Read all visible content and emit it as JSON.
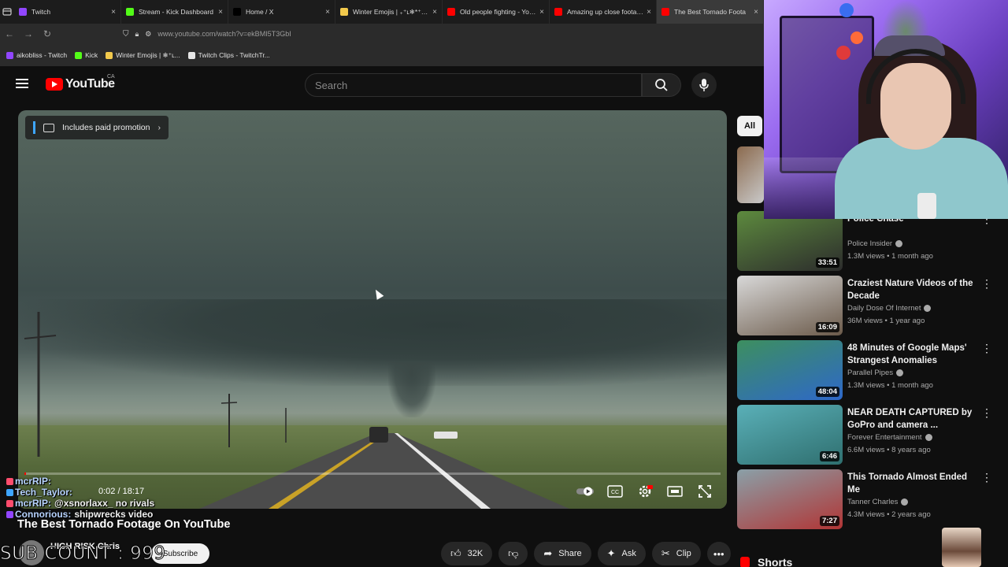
{
  "browser": {
    "tabs": [
      {
        "label": "Twitch",
        "color": "#9146ff",
        "active": false
      },
      {
        "label": "Stream - Kick Dashboard",
        "color": "#53fc18",
        "active": false
      },
      {
        "label": "Home / X",
        "color": "#000000",
        "active": false
      },
      {
        "label": "Winter Emojis | ₊⁺ʟ❄︎*⁺‧₊☃︎",
        "color": "#f2c94c",
        "active": false
      },
      {
        "label": "Old people fighting - YouTu",
        "color": "#ff0000",
        "active": false
      },
      {
        "label": "Amazing up close footage o",
        "color": "#ff0000",
        "active": false
      },
      {
        "label": "The Best Tornado Foota",
        "color": "#ff0000",
        "active": true
      }
    ],
    "url": "www.youtube.com/watch?v=ekBMI5T3GbI",
    "bookmarks": [
      {
        "label": "aikobliss - Twitch",
        "color": "#9146ff"
      },
      {
        "label": "Kick",
        "color": "#53fc18"
      },
      {
        "label": "Winter Emojis | ❄︎⁺ʟ...",
        "color": "#f2c94c"
      },
      {
        "label": "Twitch Clips - TwitchTr...",
        "color": "#e6e6e6"
      }
    ]
  },
  "youtube": {
    "logo_text": "YouTube",
    "country": "CA",
    "search_placeholder": "Search"
  },
  "video": {
    "promo_label": "Includes paid promotion",
    "time": "0:02 / 18:17",
    "progress": 0.002,
    "title": "The Best Tornado Footage On YouTube",
    "channel": "HIGH RISK Chris",
    "subscribe_label": "Subscribe",
    "like_count": "32K",
    "share_label": "Share",
    "ask_label": "Ask",
    "clip_label": "Clip"
  },
  "overlay": {
    "subcount": "SUB COUNT : 999",
    "chat": [
      {
        "name": "mcrRIP:",
        "text": ""
      },
      {
        "name": "Tech_Taylor:",
        "text": ""
      },
      {
        "name": "mcrRIP:",
        "text": "@xsnorlaxx_ no rivals"
      },
      {
        "name": "Connorious:",
        "text": "shipwrecks video"
      }
    ]
  },
  "sidebar": {
    "chip_all": "All",
    "recommendations": [
      {
        "title": "Police Chase",
        "channel": "Police Insider",
        "meta": "1.3M views • 1 month ago",
        "duration": "33:51",
        "thumb_a": "#5d8a3e",
        "thumb_b": "#2c2c2c"
      },
      {
        "title": "Craziest Nature Videos of the Decade",
        "channel": "Daily Dose Of Internet",
        "meta": "36M views • 1 year ago",
        "duration": "16:09",
        "thumb_a": "#d8d8d8",
        "thumb_b": "#6b5a4a"
      },
      {
        "title": "48 Minutes of Google Maps' Strangest Anomalies",
        "channel": "Parallel Pipes",
        "meta": "1.3M views • 1 month ago",
        "duration": "48:04",
        "thumb_a": "#3d8f5f",
        "thumb_b": "#2e68c9"
      },
      {
        "title": "NEAR DEATH CAPTURED by GoPro and camera ...",
        "channel": "Forever Entertainment",
        "meta": "6.6M views • 8 years ago",
        "duration": "6:46",
        "thumb_a": "#5ab0b8",
        "thumb_b": "#2f6f6f"
      },
      {
        "title": "This Tornado Almost Ended Me",
        "channel": "Tanner Charles",
        "meta": "4.3M views • 2 years ago",
        "duration": "7:27",
        "thumb_a": "#8aa0a8",
        "thumb_b": "#b13535"
      }
    ],
    "shorts_label": "Shorts"
  }
}
